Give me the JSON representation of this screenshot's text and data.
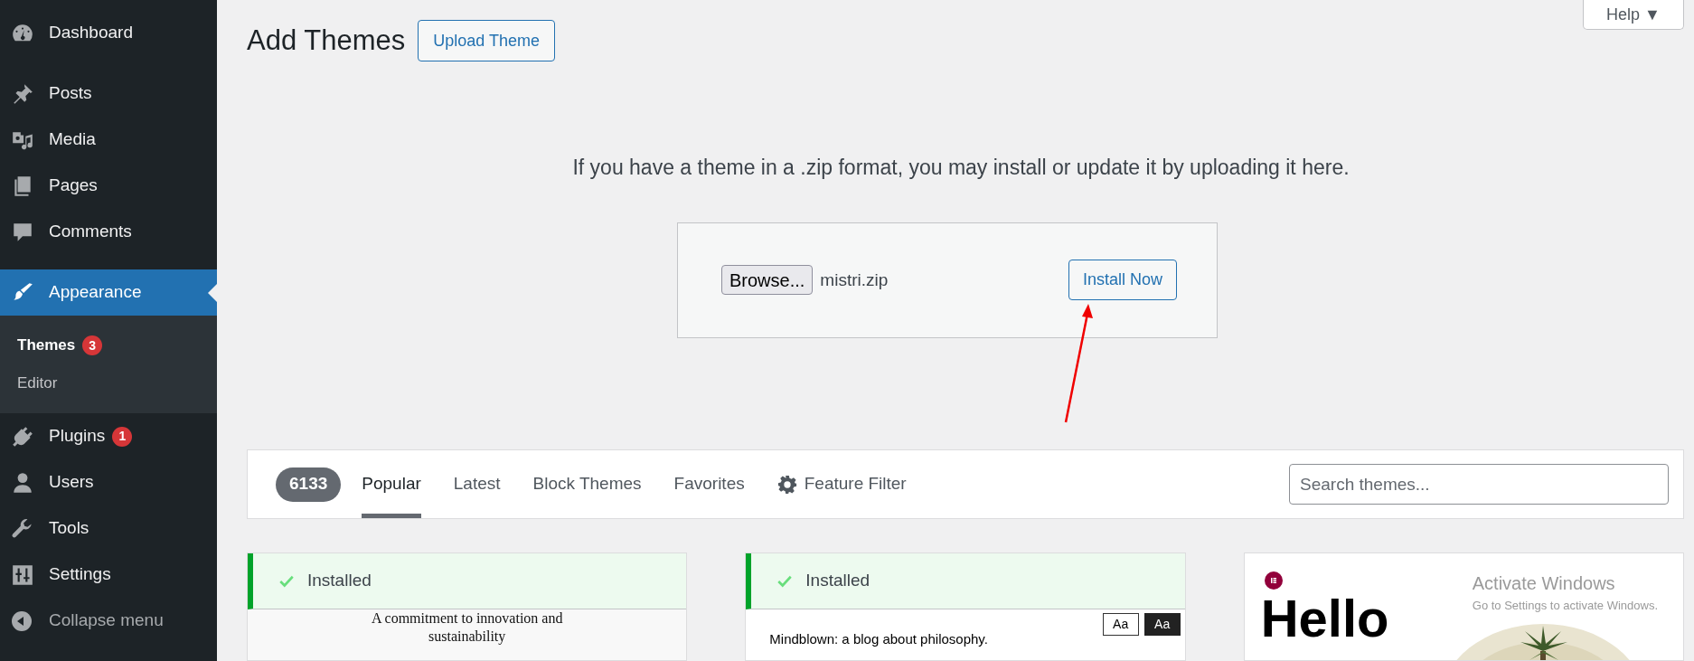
{
  "sidebar": {
    "items": [
      {
        "label": "Dashboard",
        "selected": false
      },
      {
        "label": "Posts",
        "selected": false
      },
      {
        "label": "Media",
        "selected": false
      },
      {
        "label": "Pages",
        "selected": false
      },
      {
        "label": "Comments",
        "selected": false
      },
      {
        "label": "Appearance",
        "selected": true,
        "children": [
          {
            "label": "Themes",
            "selected": true,
            "badge": "3"
          },
          {
            "label": "Editor",
            "selected": false
          }
        ]
      },
      {
        "label": "Plugins",
        "selected": false,
        "badge": "1"
      },
      {
        "label": "Users",
        "selected": false
      },
      {
        "label": "Tools",
        "selected": false
      },
      {
        "label": "Settings",
        "selected": false
      }
    ],
    "collapse_label": "Collapse menu"
  },
  "page": {
    "title": "Add Themes",
    "upload_button": "Upload Theme",
    "help_tab": "Help ▼"
  },
  "upload": {
    "instructions": "If you have a theme in a .zip format, you may install or update it by uploading it here.",
    "browse_button": "Browse...",
    "file_name": "mistri.zip",
    "install_button": "Install Now"
  },
  "filter_bar": {
    "count": "6133",
    "tabs": [
      {
        "label": "Popular",
        "selected": true
      },
      {
        "label": "Latest",
        "selected": false
      },
      {
        "label": "Block Themes",
        "selected": false
      },
      {
        "label": "Favorites",
        "selected": false
      }
    ],
    "feature_filter": "Feature Filter",
    "search": {
      "placeholder": "Search themes..."
    }
  },
  "themes": [
    {
      "kind": "serif",
      "installed": true,
      "status": "Installed",
      "preview_text": "A commitment to innovation and sustainability"
    },
    {
      "kind": "blog",
      "installed": true,
      "status": "Installed",
      "preview_text": "Mindblown: a blog about philosophy.",
      "swatches": [
        "Aa",
        "Aa"
      ]
    },
    {
      "kind": "hello",
      "installed": false,
      "preview_text": "Hello"
    }
  ],
  "activation_notice": {
    "title": "Activate Windows",
    "subtitle": "Go to Settings to activate Windows."
  }
}
